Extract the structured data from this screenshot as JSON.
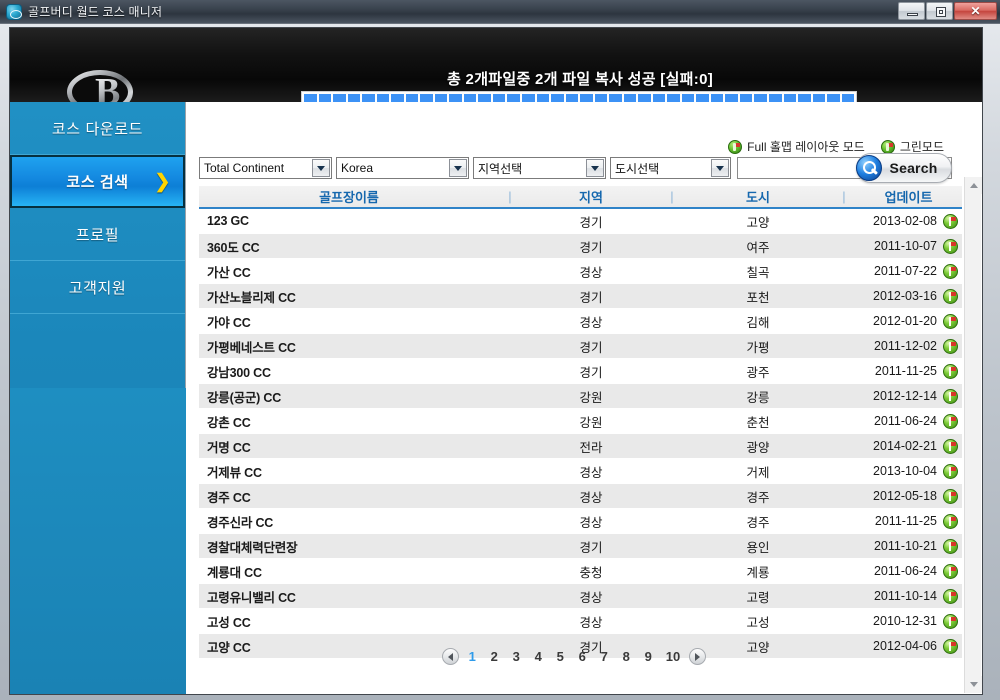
{
  "window": {
    "title": "골프버디 월드 코스 매니저",
    "icon": "app-icon",
    "buttons": {
      "minimize": "minimize",
      "maximize": "restore",
      "close": "✕"
    }
  },
  "header": {
    "logo_letter": "B",
    "status_text": "총 2개파일중 2개 파일 복사 성공 [실패:0]",
    "progress_segments": 38,
    "progress_color": "#3c92f6"
  },
  "sidebar": {
    "items": [
      {
        "label": "코스 다운로드",
        "active": false
      },
      {
        "label": "코스 검색",
        "active": true,
        "arrow": "❯"
      },
      {
        "label": "프로필",
        "active": false
      },
      {
        "label": "고객지원",
        "active": false
      }
    ]
  },
  "modes": [
    {
      "label": "Full 홀맵 레이아웃 모드",
      "icon": "green-flag-icon"
    },
    {
      "label": "그린모드",
      "icon": "green-flag-icon"
    }
  ],
  "filters": {
    "continent": {
      "value": "Total Continent"
    },
    "country": {
      "value": "Korea"
    },
    "region": {
      "value": "지역선택"
    },
    "city": {
      "value": "도시선택"
    },
    "search": {
      "value": "",
      "placeholder": ""
    },
    "search_button": "Search"
  },
  "table": {
    "columns": [
      "골프장이름",
      "지역",
      "도시",
      "업데이트"
    ],
    "separator": "|",
    "rows": [
      {
        "name": "123 GC",
        "region": "경기",
        "city": "고양",
        "updated": "2013-02-08"
      },
      {
        "name": "360도 CC",
        "region": "경기",
        "city": "여주",
        "updated": "2011-10-07"
      },
      {
        "name": "가산 CC",
        "region": "경상",
        "city": "칠곡",
        "updated": "2011-07-22"
      },
      {
        "name": "가산노블리제 CC",
        "region": "경기",
        "city": "포천",
        "updated": "2012-03-16"
      },
      {
        "name": "가야 CC",
        "region": "경상",
        "city": "김해",
        "updated": "2012-01-20"
      },
      {
        "name": "가평베네스트 CC",
        "region": "경기",
        "city": "가평",
        "updated": "2011-12-02"
      },
      {
        "name": "강남300 CC",
        "region": "경기",
        "city": "광주",
        "updated": "2011-11-25"
      },
      {
        "name": "강릉(공군) CC",
        "region": "강원",
        "city": "강릉",
        "updated": "2012-12-14"
      },
      {
        "name": "강촌 CC",
        "region": "강원",
        "city": "춘천",
        "updated": "2011-06-24"
      },
      {
        "name": "거명 CC",
        "region": "전라",
        "city": "광양",
        "updated": "2014-02-21"
      },
      {
        "name": "거제뷰 CC",
        "region": "경상",
        "city": "거제",
        "updated": "2013-10-04"
      },
      {
        "name": "경주 CC",
        "region": "경상",
        "city": "경주",
        "updated": "2012-05-18"
      },
      {
        "name": "경주신라 CC",
        "region": "경상",
        "city": "경주",
        "updated": "2011-11-25"
      },
      {
        "name": "경찰대체력단련장",
        "region": "경기",
        "city": "용인",
        "updated": "2011-10-21"
      },
      {
        "name": "계룡대 CC",
        "region": "충청",
        "city": "계룡",
        "updated": "2011-06-24"
      },
      {
        "name": "고령유니밸리 CC",
        "region": "경상",
        "city": "고령",
        "updated": "2011-10-14"
      },
      {
        "name": "고성 CC",
        "region": "경상",
        "city": "고성",
        "updated": "2010-12-31"
      },
      {
        "name": "고양 CC",
        "region": "경기",
        "city": "고양",
        "updated": "2012-04-06"
      }
    ]
  },
  "pagination": {
    "prev": "◀",
    "next": "▶",
    "pages": [
      "1",
      "2",
      "3",
      "4",
      "5",
      "6",
      "7",
      "8",
      "9",
      "10"
    ],
    "current": "1"
  },
  "colors": {
    "sidebar": "#1b87bb",
    "accent": "#2f9bea",
    "header_link": "#1668ae"
  }
}
